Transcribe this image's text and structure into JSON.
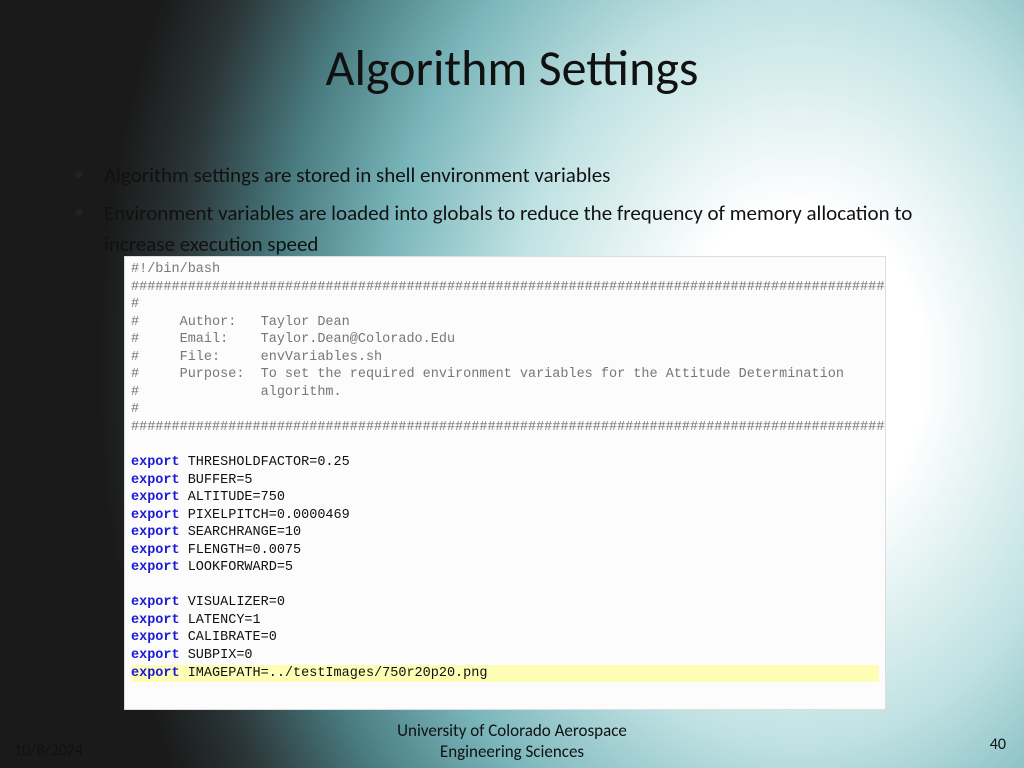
{
  "title": "Algorithm Settings",
  "bullets": [
    "Algorithm settings are stored in shell environment variables",
    "Environment variables are loaded into globals to reduce the frequency of memory allocation to increase execution speed"
  ],
  "code": {
    "shebang": "#!/bin/bash",
    "hashline": "################################################################################################",
    "h": "#",
    "author_lbl": "#     Author:   ",
    "author_val": "Taylor Dean",
    "email_lbl": "#     Email:    ",
    "email_val": "Taylor.Dean@Colorado.Edu",
    "file_lbl": "#     File:     ",
    "file_val": "envVariables.sh",
    "purpose_lbl": "#     Purpose:  ",
    "purpose_val": "To set the required environment variables for the Attitude Determination",
    "purpose2": "#               algorithm.",
    "kw": "export",
    "v1": " THRESHOLDFACTOR=0.25",
    "v2": " BUFFER=5",
    "v3": " ALTITUDE=750",
    "v4": " PIXELPITCH=0.0000469",
    "v5": " SEARCHRANGE=10",
    "v6": " FLENGTH=0.0075",
    "v7": " LOOKFORWARD=5",
    "v8": " VISUALIZER=0",
    "v9": " LATENCY=1",
    "v10": " CALIBRATE=0",
    "v11": " SUBPIX=0",
    "v12": " IMAGEPATH=../testImages/750r20p20.png"
  },
  "footer": {
    "date": "10/8/2024",
    "org1": "University of Colorado Aerospace",
    "org2": "Engineering Sciences",
    "page": "40"
  }
}
